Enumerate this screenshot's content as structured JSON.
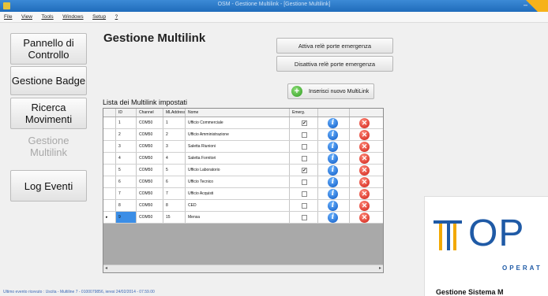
{
  "window": {
    "title": "OSM - Gestione Multilink - [Gestione Multilink]",
    "minimize_glyph": "–"
  },
  "menu": [
    "File",
    "View",
    "Tools",
    "Windows",
    "Setup",
    "?"
  ],
  "nav": [
    {
      "label": "Pannello di Controllo",
      "enabled": true
    },
    {
      "label": "Gestione Badge",
      "enabled": true
    },
    {
      "label": "Ricerca Movimenti",
      "enabled": true
    },
    {
      "label": "Gestione Multilink",
      "enabled": false
    },
    {
      "label": "Log Eventi",
      "enabled": true
    }
  ],
  "page": {
    "title": "Gestione Multilink",
    "btn_attiva": "Attiva relè porte emergenza",
    "btn_disattiva": "Disattiva relè porte emergenza",
    "btn_add": "Inserisci nuovo MultiLink",
    "list_label": "Lista dei Multilink impostati"
  },
  "table": {
    "headers": [
      "",
      "ID",
      "Channel",
      "MLAddress",
      "Nome",
      "Emerg.",
      "",
      ""
    ],
    "rows": [
      {
        "id": "1",
        "channel": "COM50",
        "address": "1",
        "name": "Ufficio Commerciale",
        "emerg": true
      },
      {
        "id": "2",
        "channel": "COM50",
        "address": "2",
        "name": "Ufficio Amministrazione",
        "emerg": false
      },
      {
        "id": "3",
        "channel": "COM50",
        "address": "3",
        "name": "Saletta Riunioni",
        "emerg": false
      },
      {
        "id": "4",
        "channel": "COM50",
        "address": "4",
        "name": "Saletta Fornitori",
        "emerg": false
      },
      {
        "id": "5",
        "channel": "COM50",
        "address": "5",
        "name": "Ufficio Laboratorio",
        "emerg": true
      },
      {
        "id": "6",
        "channel": "COM50",
        "address": "6",
        "name": "Ufficio Tecnico",
        "emerg": false
      },
      {
        "id": "7",
        "channel": "COM50",
        "address": "7",
        "name": "Ufficio Acquisti",
        "emerg": false
      },
      {
        "id": "8",
        "channel": "COM50",
        "address": "8",
        "name": "CED",
        "emerg": false
      },
      {
        "id": "9",
        "channel": "COM50",
        "address": "15",
        "name": "Mensa",
        "emerg": false,
        "current": true
      }
    ],
    "check_glyph": "✔",
    "info_glyph": "i",
    "delete_glyph": "✕",
    "row_pointer": "▸",
    "scroll_left": "◂",
    "scroll_right": "▸"
  },
  "status": "Ultimo evento ricevuto : Uscita - Multiline 7 - 0100079856, ieresi 24/02/2014 - 07.59.00",
  "logo": {
    "brand": "OP",
    "tagline": "OPERAT",
    "caption": "Gestione Sistema M"
  },
  "colors": {
    "accent": "#1f5aa6",
    "logo_gold": "#f2a900",
    "titlebar": "#2a7bcb",
    "selection": "#3b8ee6"
  }
}
